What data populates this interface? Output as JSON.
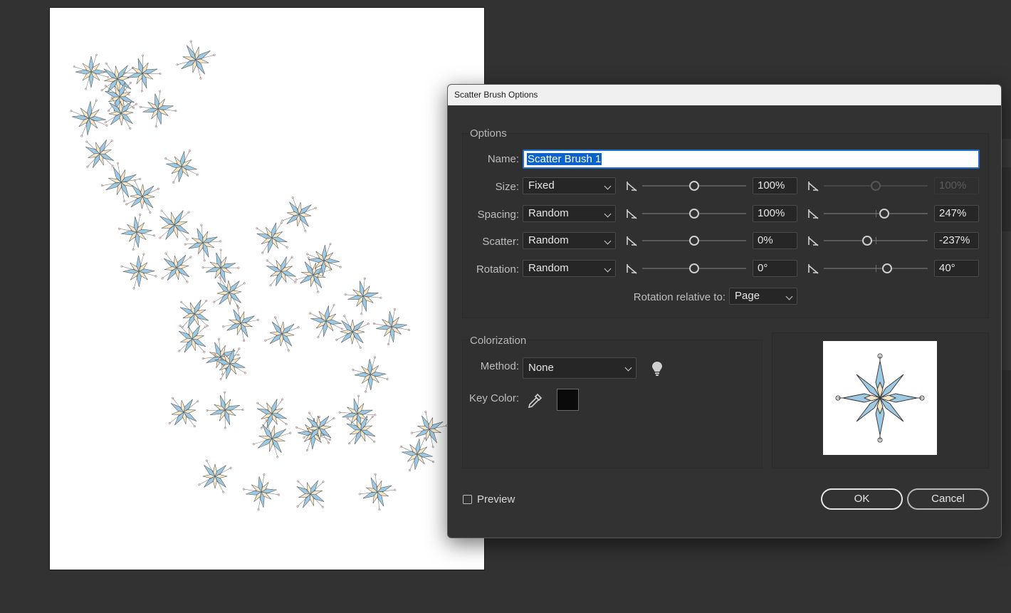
{
  "dialog": {
    "title": "Scatter Brush Options",
    "options_group": {
      "title": "Options",
      "name": {
        "label": "Name:",
        "value": "Scatter Brush 1"
      },
      "rows": [
        {
          "label": "Size:",
          "method": "Fixed",
          "min_value": "100%",
          "max_value": "100%",
          "max_disabled": true
        },
        {
          "label": "Spacing:",
          "method": "Random",
          "min_value": "100%",
          "max_value": "247%",
          "max_disabled": false
        },
        {
          "label": "Scatter:",
          "method": "Random",
          "min_value": "0%",
          "max_value": "-237%",
          "max_disabled": false
        },
        {
          "label": "Rotation:",
          "method": "Random",
          "min_value": "0°",
          "max_value": "40°",
          "max_disabled": false
        }
      ],
      "rotation_relative_label": "Rotation relative to:",
      "rotation_relative_value": "Page"
    },
    "colorization_group": {
      "title": "Colorization",
      "method_label": "Method:",
      "method_value": "None",
      "key_color_label": "Key Color:",
      "key_color": "#0a0a0a",
      "tips_icon": "lightbulb-icon",
      "eyedropper_icon": "eyedropper-icon"
    },
    "preview_checkbox": {
      "label": "Preview",
      "checked": false
    },
    "ok_label": "OK",
    "cancel_label": "Cancel"
  },
  "colors": {
    "background": "#323232",
    "artboard": "#ffffff",
    "star_blue": "#9ec9e2",
    "star_cream": "#f3e6c8",
    "selection": "#0a62cf"
  }
}
